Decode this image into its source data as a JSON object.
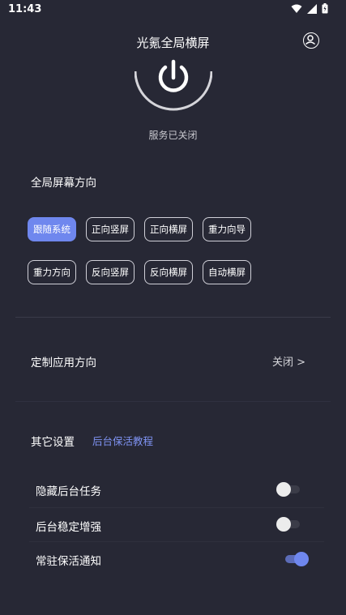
{
  "status_bar": {
    "time": "11:43"
  },
  "header": {
    "title": "光氪全局横屏"
  },
  "service": {
    "status": "服务已关闭"
  },
  "orientation": {
    "title": "全局屏幕方向",
    "options": [
      "跟随系统",
      "正向竖屏",
      "正向横屏",
      "重力向导",
      "重力方向",
      "反向竖屏",
      "反向横屏",
      "自动横屏"
    ],
    "selected": "跟随系统"
  },
  "custom_app": {
    "label": "定制应用方向",
    "value": "关闭 >"
  },
  "other_settings": {
    "title": "其它设置",
    "tutorial_link": "后台保活教程",
    "toggles": [
      {
        "label": "隐藏后台任务",
        "state": "off"
      },
      {
        "label": "后台稳定增强",
        "state": "off"
      },
      {
        "label": "常驻保活通知",
        "state": "on"
      }
    ]
  },
  "colors": {
    "background": "#272835",
    "accent": "#6f87ee",
    "link": "#7f93f2"
  }
}
